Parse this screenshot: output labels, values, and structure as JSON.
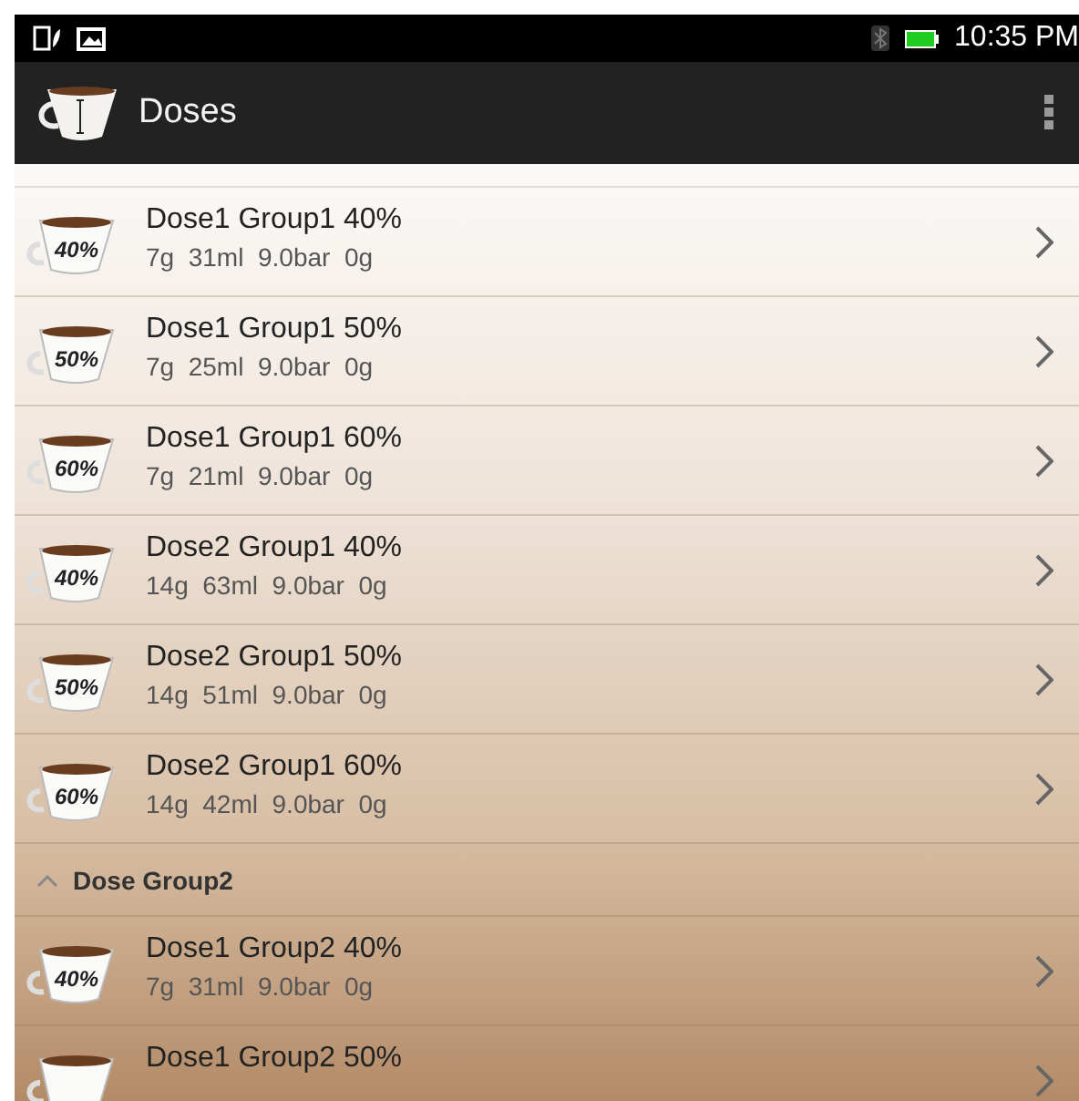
{
  "status_bar": {
    "time": "10:35 PM"
  },
  "action_bar": {
    "title": "Doses"
  },
  "groups": [
    {
      "items": [
        {
          "title": "Dose1 Group1 40%",
          "details": "7g  31ml  9.0bar  0g",
          "cup_label": "40%"
        },
        {
          "title": "Dose1 Group1 50%",
          "details": "7g  25ml  9.0bar  0g",
          "cup_label": "50%"
        },
        {
          "title": "Dose1 Group1 60%",
          "details": "7g  21ml  9.0bar  0g",
          "cup_label": "60%"
        },
        {
          "title": "Dose2 Group1 40%",
          "details": "14g  63ml  9.0bar  0g",
          "cup_label": "40%"
        },
        {
          "title": "Dose2 Group1 50%",
          "details": "14g  51ml  9.0bar  0g",
          "cup_label": "50%"
        },
        {
          "title": "Dose2 Group1 60%",
          "details": "14g  42ml  9.0bar  0g",
          "cup_label": "60%"
        }
      ]
    },
    {
      "title": "Dose Group2",
      "expanded": true,
      "items": [
        {
          "title": "Dose1 Group2 40%",
          "details": "7g  31ml  9.0bar  0g",
          "cup_label": "40%"
        },
        {
          "title": "Dose1 Group2 50%"
        }
      ]
    }
  ]
}
